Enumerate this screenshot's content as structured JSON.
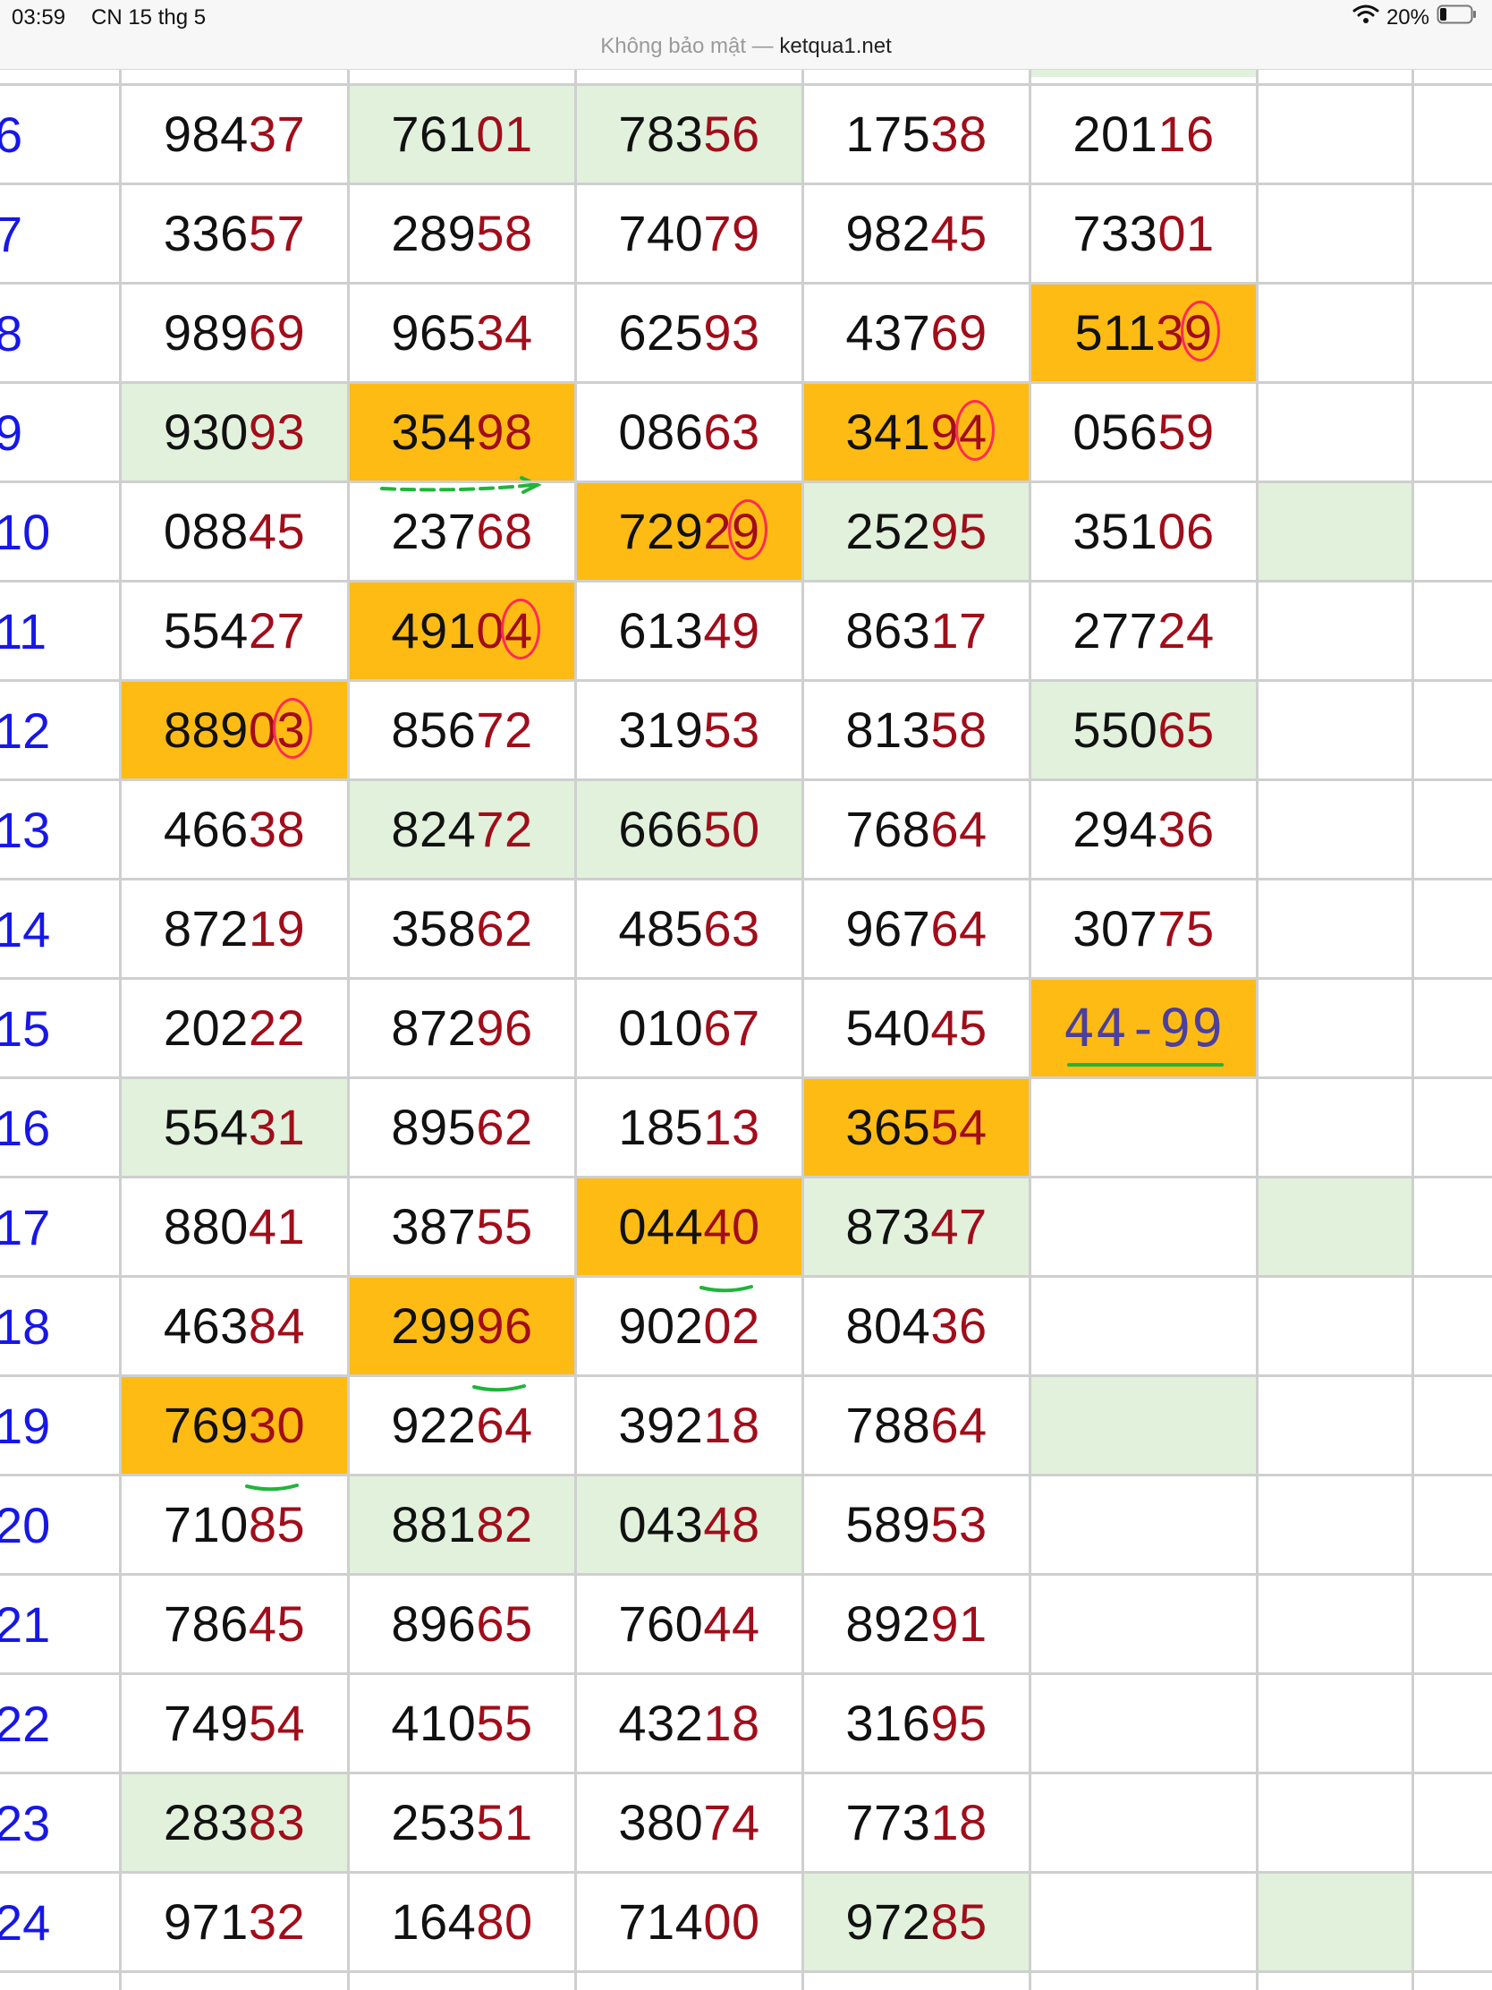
{
  "status_bar": {
    "time": "03:59",
    "date": "CN 15 thg 5",
    "battery": "20%",
    "url_prefix": "Không bảo mật —",
    "url_domain": "ketqua1.net"
  },
  "rows": [
    {
      "label": "6",
      "cells": [
        [
          "984",
          "37"
        ],
        [
          "761",
          "01"
        ],
        [
          "783",
          "56"
        ],
        [
          "175",
          "38"
        ],
        [
          "201",
          "16"
        ]
      ]
    },
    {
      "label": "7",
      "cells": [
        [
          "336",
          "57"
        ],
        [
          "289",
          "58"
        ],
        [
          "740",
          "79"
        ],
        [
          "982",
          "45"
        ],
        [
          "733",
          "01"
        ]
      ]
    },
    {
      "label": "8",
      "cells": [
        [
          "989",
          "69"
        ],
        [
          "965",
          "34"
        ],
        [
          "625",
          "93"
        ],
        [
          "437",
          "69"
        ],
        [
          "511",
          "39"
        ]
      ]
    },
    {
      "label": "9",
      "cells": [
        [
          "930",
          "93"
        ],
        [
          "354",
          "98"
        ],
        [
          "086",
          "63"
        ],
        [
          "341",
          "94"
        ],
        [
          "056",
          "59"
        ]
      ]
    },
    {
      "label": "10",
      "cells": [
        [
          "088",
          "45"
        ],
        [
          "237",
          "68"
        ],
        [
          "729",
          "29"
        ],
        [
          "252",
          "95"
        ],
        [
          "351",
          "06"
        ]
      ]
    },
    {
      "label": "11",
      "cells": [
        [
          "554",
          "27"
        ],
        [
          "491",
          "04"
        ],
        [
          "613",
          "49"
        ],
        [
          "863",
          "17"
        ],
        [
          "277",
          "24"
        ]
      ]
    },
    {
      "label": "12",
      "cells": [
        [
          "889",
          "03"
        ],
        [
          "856",
          "72"
        ],
        [
          "319",
          "53"
        ],
        [
          "813",
          "58"
        ],
        [
          "550",
          "65"
        ]
      ]
    },
    {
      "label": "13",
      "cells": [
        [
          "466",
          "38"
        ],
        [
          "824",
          "72"
        ],
        [
          "666",
          "50"
        ],
        [
          "768",
          "64"
        ],
        [
          "294",
          "36"
        ]
      ]
    },
    {
      "label": "14",
      "cells": [
        [
          "872",
          "19"
        ],
        [
          "358",
          "62"
        ],
        [
          "485",
          "63"
        ],
        [
          "967",
          "64"
        ],
        [
          "307",
          "75"
        ]
      ]
    },
    {
      "label": "15",
      "cells": [
        [
          "202",
          "22"
        ],
        [
          "872",
          "96"
        ],
        [
          "010",
          "67"
        ],
        [
          "540",
          "45"
        ],
        [
          "",
          ""
        ]
      ]
    },
    {
      "label": "16",
      "cells": [
        [
          "554",
          "31"
        ],
        [
          "895",
          "62"
        ],
        [
          "185",
          "13"
        ],
        [
          "365",
          "54"
        ]
      ]
    },
    {
      "label": "17",
      "cells": [
        [
          "880",
          "41"
        ],
        [
          "387",
          "55"
        ],
        [
          "044",
          "40"
        ],
        [
          "873",
          "47"
        ]
      ]
    },
    {
      "label": "18",
      "cells": [
        [
          "463",
          "84"
        ],
        [
          "299",
          "96"
        ],
        [
          "902",
          "02"
        ],
        [
          "804",
          "36"
        ]
      ]
    },
    {
      "label": "19",
      "cells": [
        [
          "769",
          "30"
        ],
        [
          "922",
          "64"
        ],
        [
          "392",
          "18"
        ],
        [
          "788",
          "64"
        ]
      ]
    },
    {
      "label": "20",
      "cells": [
        [
          "710",
          "85"
        ],
        [
          "881",
          "82"
        ],
        [
          "043",
          "48"
        ],
        [
          "589",
          "53"
        ]
      ]
    },
    {
      "label": "21",
      "cells": [
        [
          "786",
          "45"
        ],
        [
          "896",
          "65"
        ],
        [
          "760",
          "44"
        ],
        [
          "892",
          "91"
        ]
      ]
    },
    {
      "label": "22",
      "cells": [
        [
          "749",
          "54"
        ],
        [
          "410",
          "55"
        ],
        [
          "432",
          "18"
        ],
        [
          "316",
          "95"
        ]
      ]
    },
    {
      "label": "23",
      "cells": [
        [
          "283",
          "83"
        ],
        [
          "253",
          "51"
        ],
        [
          "380",
          "74"
        ],
        [
          "773",
          "18"
        ]
      ]
    },
    {
      "label": "24",
      "cells": [
        [
          "971",
          "32"
        ],
        [
          "164",
          "80"
        ],
        [
          "714",
          "00"
        ],
        [
          "972",
          "85"
        ]
      ]
    }
  ],
  "annotation": {
    "text": "44-99"
  },
  "colors": {
    "head_digits": "#111111",
    "tail_digits": "#a10d1a",
    "row_label": "#1717e8",
    "green_highlight": "#e1f1dc",
    "orange_highlight": "#fdbb14",
    "circle_mark": "#ff2a56",
    "underline_mark": "#1fb53a",
    "handwriting": "#4b3fa0"
  },
  "icons": [
    "wifi-icon",
    "battery-icon"
  ]
}
